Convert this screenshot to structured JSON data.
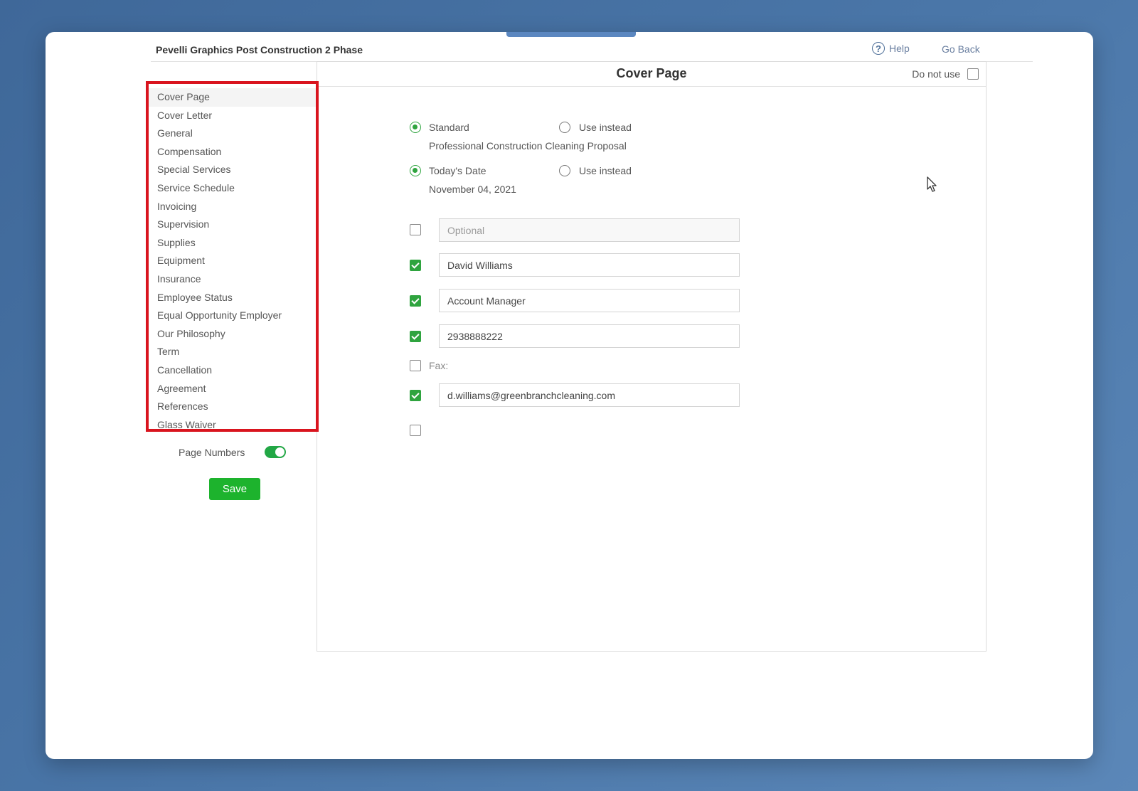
{
  "header": {
    "title": "Pevelli Graphics Post Construction 2 Phase",
    "help_label": "Help",
    "go_back_label": "Go Back"
  },
  "panel": {
    "title": "Cover Page",
    "do_not_use_label": "Do not use",
    "do_not_use_checked": false
  },
  "sidebar": {
    "items": [
      {
        "label": "Cover Page",
        "active": true
      },
      {
        "label": "Cover Letter"
      },
      {
        "label": "General"
      },
      {
        "label": "Compensation"
      },
      {
        "label": "Special Services"
      },
      {
        "label": "Service Schedule"
      },
      {
        "label": "Invoicing"
      },
      {
        "label": "Supervision"
      },
      {
        "label": "Supplies"
      },
      {
        "label": "Equipment"
      },
      {
        "label": "Insurance"
      },
      {
        "label": "Employee Status"
      },
      {
        "label": "Equal Opportunity Employer"
      },
      {
        "label": "Our Philosophy"
      },
      {
        "label": "Term"
      },
      {
        "label": "Cancellation"
      },
      {
        "label": "Agreement"
      },
      {
        "label": "References"
      },
      {
        "label": "Glass Waiver"
      }
    ],
    "page_numbers_label": "Page Numbers",
    "page_numbers_on": true,
    "save_label": "Save"
  },
  "title_option": {
    "standard_label": "Standard",
    "use_instead_label": "Use instead",
    "selected": "standard",
    "standard_text": "Professional Construction Cleaning Proposal"
  },
  "date_option": {
    "todays_date_label": "Today's Date",
    "use_instead_label": "Use instead",
    "selected": "todays_date",
    "date_text": "November 04, 2021"
  },
  "fields": {
    "optional": {
      "checked": false,
      "value": "",
      "placeholder": "Optional"
    },
    "name": {
      "checked": true,
      "value": "David Williams"
    },
    "role": {
      "checked": true,
      "value": "Account Manager"
    },
    "phone": {
      "checked": true,
      "value": "2938888222"
    },
    "fax": {
      "checked": false,
      "label": "Fax:"
    },
    "email": {
      "checked": true,
      "value": "d.williams@greenbranchcleaning.com"
    },
    "extra": {
      "checked": false
    }
  },
  "icons": {
    "help": "question-circle-icon",
    "cursor": "mouse-pointer-icon"
  },
  "colors": {
    "accent_green": "#1db32d",
    "highlight_red": "#d9141e",
    "background_blue": "#4a76a8"
  }
}
